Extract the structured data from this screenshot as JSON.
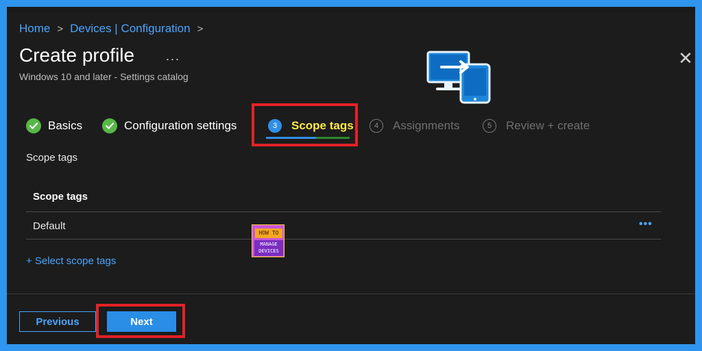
{
  "breadcrumb": {
    "items": [
      "Home",
      "Devices | Configuration"
    ],
    "separator": ">"
  },
  "header": {
    "title": "Create profile",
    "more": "...",
    "subtitle": "Windows 10 and later - Settings catalog",
    "close": "✕"
  },
  "wizard": {
    "steps": [
      {
        "label": "Basics",
        "state": "done"
      },
      {
        "label": "Configuration settings",
        "state": "done"
      },
      {
        "num": "3",
        "label": "Scope tags",
        "state": "active"
      },
      {
        "num": "4",
        "label": "Assignments",
        "state": "future"
      },
      {
        "num": "5",
        "label": "Review + create",
        "state": "future"
      }
    ]
  },
  "content": {
    "section_label": "Scope tags",
    "table_header": "Scope tags",
    "rows": [
      {
        "value": "Default",
        "more": "•••"
      }
    ],
    "select_link": "+ Select scope tags"
  },
  "watermark": {
    "line1": "HOW TO",
    "line2": "MANAGE",
    "line3": "DEVICES"
  },
  "footer": {
    "previous": "Previous",
    "next": "Next"
  },
  "colors": {
    "accent": "#4aa5ff",
    "background": "#1c1c1c",
    "border": "#2f95ee",
    "highlight": "#e32226",
    "done_check": "#57b846",
    "active_label": "#ffe84d"
  }
}
